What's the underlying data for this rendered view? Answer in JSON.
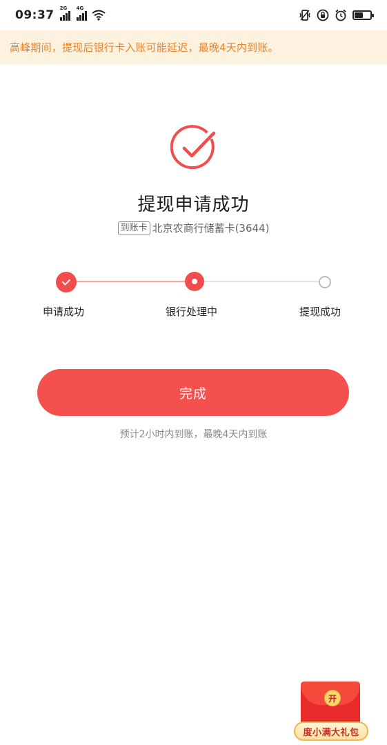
{
  "status_bar": {
    "time": "09:37",
    "sim1_tag": "2G",
    "sim2_tag": "4G",
    "battery_level": 0.55,
    "icons": [
      "signal-icon",
      "wifi-icon",
      "vibrate-icon",
      "lock-rotation-icon",
      "alarm-icon",
      "battery-icon"
    ]
  },
  "notice": {
    "text": "高峰期间，提现后银行卡入账可能延迟，最晚4天内到账。"
  },
  "result": {
    "title": "提现申请成功",
    "card_tag": "到账卡",
    "card_name": "北京农商行储蓄卡(3644)"
  },
  "steps": [
    {
      "label": "申请成功",
      "state": "done"
    },
    {
      "label": "银行处理中",
      "state": "current"
    },
    {
      "label": "提现成功",
      "state": "pending"
    }
  ],
  "done_button": {
    "label": "完成"
  },
  "hint": "预计2小时内到账，最晚4天内到账",
  "gift": {
    "coin_label": "开",
    "label": "度小满大礼包"
  },
  "colors": {
    "accent": "#f4514e",
    "notice_bg": "#fdf1e0",
    "notice_text": "#e7852b"
  }
}
